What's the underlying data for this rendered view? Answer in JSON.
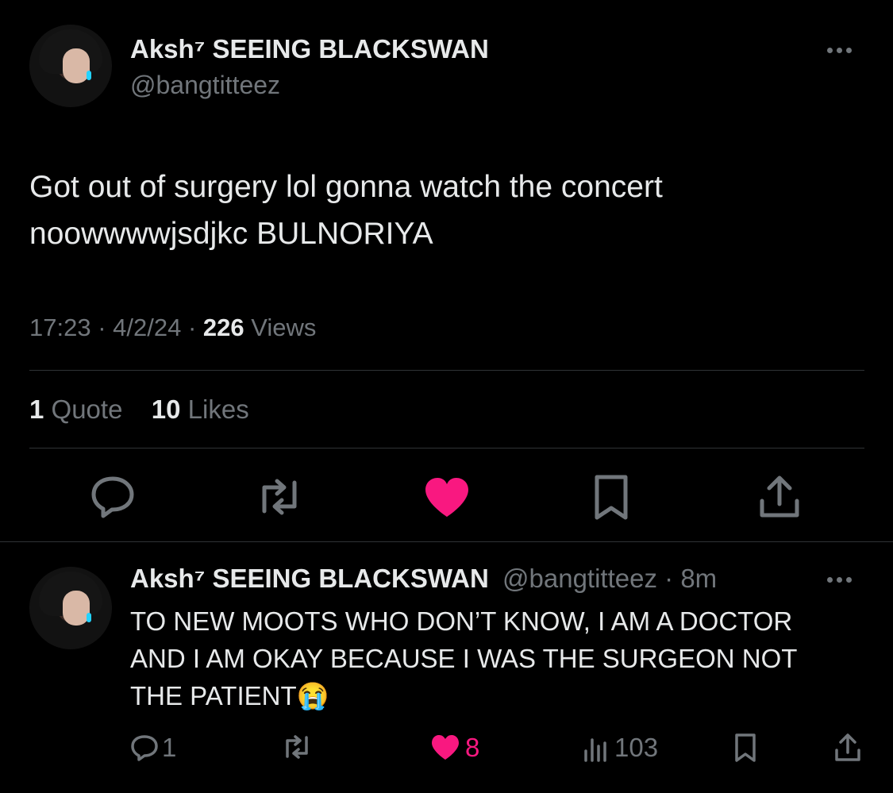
{
  "main_tweet": {
    "display_name": "Aksh⁷ SEEING BLACKSWAN",
    "handle": "@bangtitteez",
    "text_line1": "Got out of surgery lol gonna watch the concert",
    "text_line2": "noowwwwjsdjkc BULNORIYA",
    "time": "17:23",
    "date": "4/2/24",
    "views_count": "226",
    "views_label": "Views",
    "quote_count": "1",
    "quote_label": "Quote",
    "likes_count": "10",
    "likes_label": "Likes"
  },
  "reply": {
    "display_name": "Aksh⁷ SEEING BLACKSWAN",
    "handle": "@bangtitteez",
    "age": "8m",
    "text_line1": "TO NEW MOOTS WHO DON’T KNOW, I AM A DOCTOR",
    "text_line2": "AND I AM OKAY BECAUSE I WAS THE SURGEON NOT",
    "text_line3": "THE PATIENT",
    "emoji": "😭",
    "reply_count": "1",
    "like_count": "8",
    "views_count": "103"
  },
  "colors": {
    "background": "#000000",
    "text": "#e7e9ea",
    "muted": "#71767b",
    "like": "#f91880",
    "divider": "#2f3336"
  },
  "icons": [
    "reply-icon",
    "retweet-icon",
    "heart-icon",
    "bookmark-icon",
    "share-icon",
    "views-icon",
    "more-icon"
  ]
}
